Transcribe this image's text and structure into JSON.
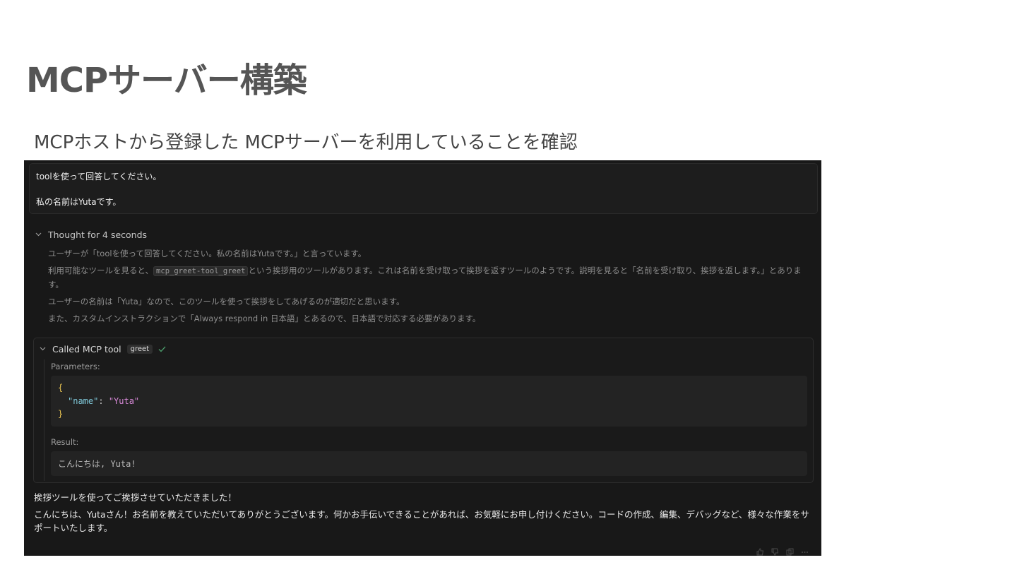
{
  "slide": {
    "title": "MCPサーバー構築",
    "subtitle": "MCPホストから登録した MCPサーバーを利用していることを確認"
  },
  "chat": {
    "prompt_lines": [
      "toolを使って回答してください。",
      "私の名前はYutaです。"
    ],
    "thought_header": "Thought for 4 seconds",
    "thought": {
      "line1": "ユーザーが「toolを使って回答してください。私の名前はYutaです。」と言っています。",
      "line2_before": "利用可能なツールを見ると、",
      "line2_code": "mcp_greet-tool_greet",
      "line2_after": "という挨拶用のツールがあります。これは名前を受け取って挨拶を返すツールのようです。説明を見ると「名前を受け取り、挨拶を返します。」とあります。",
      "line3": "ユーザーの名前は「Yuta」なので、このツールを使って挨拶をしてあげるのが適切だと思います。",
      "line4": "また、カスタムインストラクションで「Always respond in 日本語」とあるので、日本語で対応する必要があります。"
    },
    "tool": {
      "header": "Called MCP tool",
      "badge": "greet",
      "parameters_label": "Parameters:",
      "json_open": "{",
      "json_key": "\"name\"",
      "json_colon": ": ",
      "json_value": "\"Yuta\"",
      "json_close": "}",
      "result_label": "Result:",
      "result_value": "こんにちは, Yuta!"
    },
    "answer": {
      "line1": "挨拶ツールを使ってご挨拶させていただきました！",
      "line2": "こんにちは、Yutaさん！お名前を教えていただいてありがとうございます。何かお手伝いできることがあれば、お気軽にお申し付けください。コードの作成、編集、デバッグなど、様々な作業をサポートいたします。"
    },
    "icons": {
      "thought_chevron": "chevron-down-icon",
      "tool_chevron": "chevron-down-icon",
      "success": "check-icon",
      "actions": [
        "thumbs-up-icon",
        "thumbs-down-icon",
        "copy-icon",
        "more-icon"
      ]
    }
  }
}
